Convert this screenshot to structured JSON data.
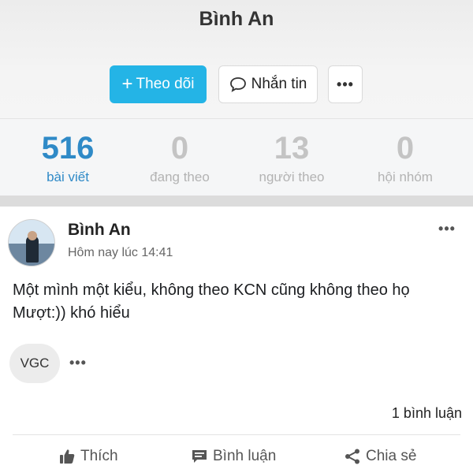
{
  "profile": {
    "name": "Bình An",
    "follow_label": "Theo dõi",
    "follow_plus": "+",
    "message_label": "Nhắn tin",
    "more_label": "•••"
  },
  "stats": [
    {
      "value": "516",
      "label": "bài viết"
    },
    {
      "value": "0",
      "label": "đang theo"
    },
    {
      "value": "13",
      "label": "người theo"
    },
    {
      "value": "0",
      "label": "hội nhóm"
    }
  ],
  "post": {
    "author": "Bình An",
    "time": "Hôm nay lúc 14:41",
    "menu_label": "•••",
    "text": "Một mình một kiểu, không theo KCN cũng không theo họ Mượt:)) khó hiểu",
    "tag": "VGC",
    "tag_more": "•••",
    "comment_count": "1 bình luận",
    "actions": {
      "like": "Thích",
      "comment": "Bình luận",
      "share": "Chia sẻ"
    }
  },
  "colors": {
    "accent": "#24b4e6",
    "active_stat": "#2f8ac7"
  },
  "icons": [
    "plus-icon",
    "chat-bubble-icon",
    "more-icon",
    "thumbs-up-icon",
    "comment-icon",
    "share-icon"
  ]
}
